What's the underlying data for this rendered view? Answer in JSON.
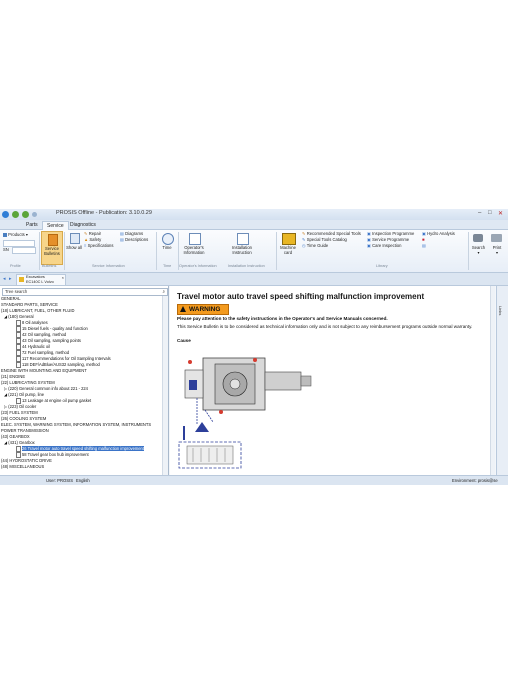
{
  "window": {
    "title": "PROSIS Offline - Publication: 3.10.0.29"
  },
  "tabs": [
    "Parts",
    "Service",
    "Diagnostics"
  ],
  "ribbon": {
    "products_label": "Products",
    "sn_label": "SN",
    "profile_group": "Profile",
    "bulletins": {
      "label": "Service Bulletins",
      "group": "Bulletins"
    },
    "show_all": "Show all",
    "repair": "Repair",
    "safety": "Safety",
    "specifications": "Specifications",
    "diagrams": "Diagrams",
    "descriptions": "Descriptions",
    "service_info_group": "Service Information",
    "time": "Time",
    "time_group": "Time",
    "operators_information": "Operator's Information",
    "operators_group": "Operator's Information",
    "installation_instruction": "Installation Instruction",
    "installation_group": "Installation Instruction",
    "machine_card": "Machine card",
    "recommended_special_tools": "Recommended Special Tools",
    "special_tools_catalog": "Special Tools Catalog",
    "time_guide": "Time Guide",
    "inspection_programme": "Inspection Programme",
    "service_programme": "Service Programme",
    "care_inspection": "Care Inspection",
    "hydro_analysis": "Hydro Analysis",
    "library_group": "Library",
    "search": "Search",
    "print": "Print"
  },
  "doc_tab": {
    "line1": "Excavators",
    "line2": "EC140C L Volvo"
  },
  "tree": {
    "search_placeholder": "Tree search",
    "items": [
      {
        "text": "GENERAL"
      },
      {
        "text": "STANDARD PARTS, SERVICE"
      },
      {
        "text": "(18) LUBRICANT, FUEL, OTHER FLUID"
      },
      {
        "text": "◢ (180) General"
      },
      {
        "text": "8 Oil analyses",
        "doc": true
      },
      {
        "text": "15 Diesel fuels - quality and function",
        "doc": true
      },
      {
        "text": "42 Oil sampling, method",
        "doc": true
      },
      {
        "text": "43 Oil sampling, sampling points",
        "doc": true
      },
      {
        "text": "44 Hydraulic oil",
        "doc": true
      },
      {
        "text": "72 Fuel sampling, method",
        "doc": true
      },
      {
        "text": "117 Recommendations for Oil Sampling Intervals",
        "doc": true
      },
      {
        "text": "118 DEF/AdBlue/AUS32 sampling, method",
        "doc": true
      },
      {
        "text": "ENGINE WITH MOUNTING AND EQUIPMENT"
      },
      {
        "text": "(21) ENGINE"
      },
      {
        "text": "(22) LUBRICATING SYSTEM"
      },
      {
        "text": "▷ (220) General common info about 221 - 224"
      },
      {
        "text": "◢ (221) Oil pump, line"
      },
      {
        "text": "13 Leakage at engine oil pump gasket",
        "doc": true
      },
      {
        "text": "▷ (223) Oil cooler"
      },
      {
        "text": "(23) FUEL SYSTEM"
      },
      {
        "text": "(26) COOLING SYSTEM"
      },
      {
        "text": "ELEC. SYSTEM, WARNING SYSTEM, INFORMATION SYSTEM, INSTRUMENTS"
      },
      {
        "text": "POWER TRANSMISSION"
      },
      {
        "text": "(43) GEARBOX"
      },
      {
        "text": "◢ (431) Gearbox"
      },
      {
        "text": "26 Travel motor auto travel speed shifting malfunction improvement",
        "doc": true,
        "selected": true
      },
      {
        "text": "58 Travel gear box hub improvement",
        "doc": true
      },
      {
        "text": "(44) HYDROSTATIC DRIVE"
      },
      {
        "text": "(48) MISCELLANEOUS"
      }
    ]
  },
  "document": {
    "title": "Travel motor auto travel speed shifting malfunction improvement",
    "warning_label": "WARNING",
    "safety_note": "Please pay attention to the safety instructions in the Operator's and Service Manuals concerned.",
    "bulletin_note": "This Service Bulletin is to be considered as technical information only and is not subject to any reimbursement programs outside normal warranty.",
    "cause_label": "Cause"
  },
  "side_panel_label": "Links",
  "status": {
    "user": "User: PROSIS",
    "language": "English",
    "environment": "Environment: prosis@se"
  },
  "colors": {
    "accent": "#3b74c8",
    "warning": "#f39a1e"
  }
}
